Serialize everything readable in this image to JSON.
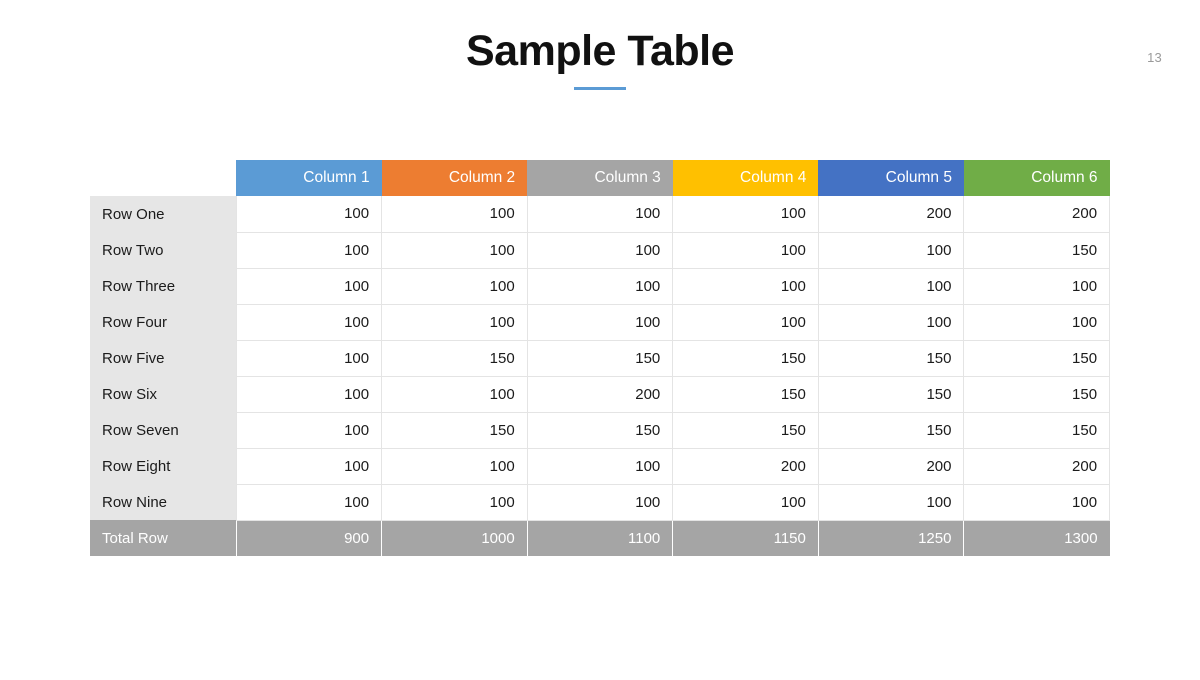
{
  "slide": {
    "title": "Sample Table",
    "page_number": "13",
    "accent_color": "#5b9bd5"
  },
  "table": {
    "corner_label": "",
    "columns": [
      {
        "label": "Column 1",
        "color": "#5b9bd5"
      },
      {
        "label": "Column 2",
        "color": "#ed7d31"
      },
      {
        "label": "Column 3",
        "color": "#a5a5a5"
      },
      {
        "label": "Column 4",
        "color": "#ffc000"
      },
      {
        "label": "Column 5",
        "color": "#4472c4"
      },
      {
        "label": "Column 6",
        "color": "#70ad47"
      }
    ],
    "rows": [
      {
        "label": "Row One",
        "values": [
          "100",
          "100",
          "100",
          "100",
          "200",
          "200"
        ]
      },
      {
        "label": "Row Two",
        "values": [
          "100",
          "100",
          "100",
          "100",
          "100",
          "150"
        ]
      },
      {
        "label": "Row Three",
        "values": [
          "100",
          "100",
          "100",
          "100",
          "100",
          "100"
        ]
      },
      {
        "label": "Row Four",
        "values": [
          "100",
          "100",
          "100",
          "100",
          "100",
          "100"
        ]
      },
      {
        "label": "Row Five",
        "values": [
          "100",
          "150",
          "150",
          "150",
          "150",
          "150"
        ]
      },
      {
        "label": "Row Six",
        "values": [
          "100",
          "100",
          "200",
          "150",
          "150",
          "150"
        ]
      },
      {
        "label": "Row Seven",
        "values": [
          "100",
          "150",
          "150",
          "150",
          "150",
          "150"
        ]
      },
      {
        "label": "Row Eight",
        "values": [
          "100",
          "100",
          "100",
          "200",
          "200",
          "200"
        ]
      },
      {
        "label": "Row Nine",
        "values": [
          "100",
          "100",
          "100",
          "100",
          "100",
          "100"
        ]
      }
    ],
    "total_row": {
      "label": "Total Row",
      "values": [
        "900",
        "1000",
        "1100",
        "1150",
        "1250",
        "1300"
      ],
      "background": "#a5a5a5"
    }
  },
  "chart_data": {
    "type": "table",
    "title": "Sample Table",
    "columns": [
      "",
      "Column 1",
      "Column 2",
      "Column 3",
      "Column 4",
      "Column 5",
      "Column 6"
    ],
    "rows": [
      [
        "Row One",
        100,
        100,
        100,
        100,
        200,
        200
      ],
      [
        "Row Two",
        100,
        100,
        100,
        100,
        100,
        150
      ],
      [
        "Row Three",
        100,
        100,
        100,
        100,
        100,
        100
      ],
      [
        "Row Four",
        100,
        100,
        100,
        100,
        100,
        100
      ],
      [
        "Row Five",
        100,
        150,
        150,
        150,
        150,
        150
      ],
      [
        "Row Six",
        100,
        100,
        200,
        150,
        150,
        150
      ],
      [
        "Row Seven",
        100,
        150,
        150,
        150,
        150,
        150
      ],
      [
        "Row Eight",
        100,
        100,
        100,
        200,
        200,
        200
      ],
      [
        "Row Nine",
        100,
        100,
        100,
        100,
        100,
        100
      ],
      [
        "Total Row",
        900,
        1000,
        1100,
        1150,
        1250,
        1300
      ]
    ]
  }
}
